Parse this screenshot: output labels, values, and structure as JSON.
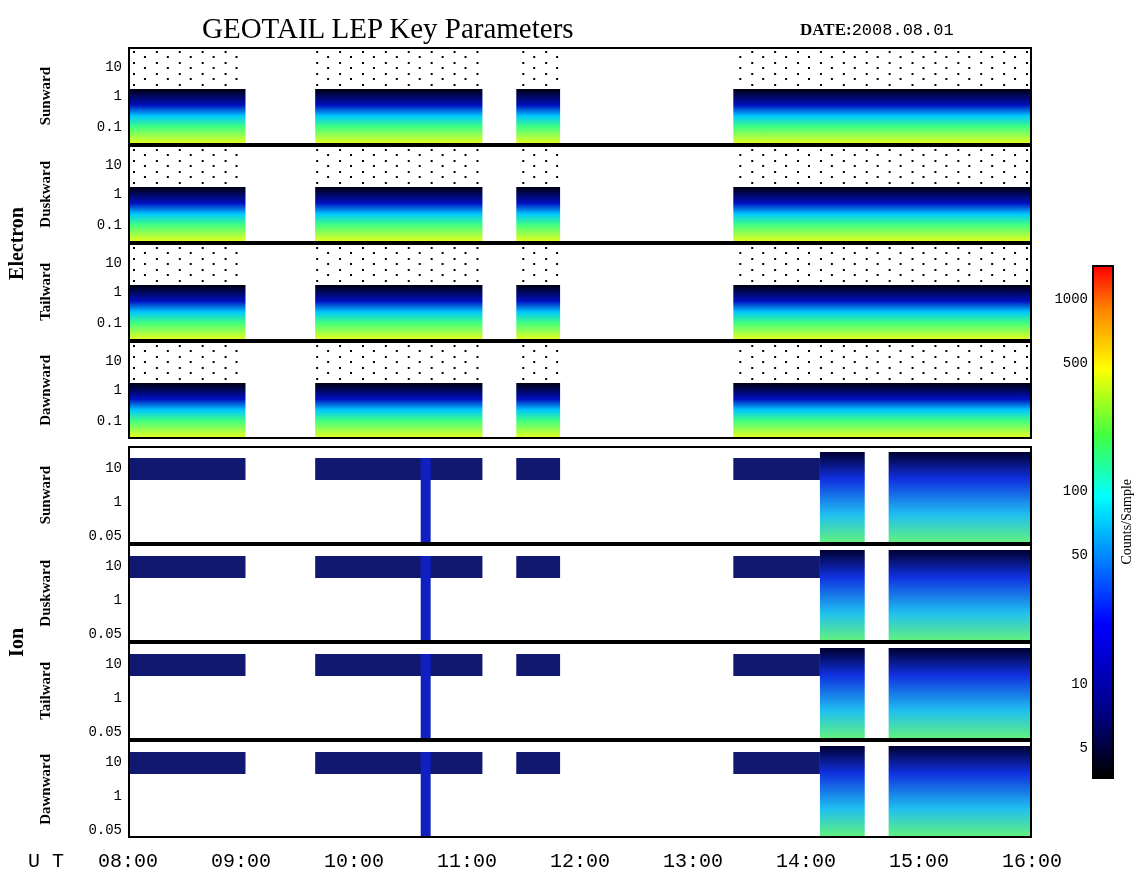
{
  "title": "GEOTAIL LEP Key Parameters",
  "date": {
    "label": "DATE:",
    "value": "2008.08.01"
  },
  "groups": [
    {
      "name": "Electron",
      "kind": "electron",
      "panels": [
        {
          "direction": "Sunward",
          "yticks": [
            "10",
            "1",
            "0.1"
          ]
        },
        {
          "direction": "Duskward",
          "yticks": [
            "10",
            "1",
            "0.1"
          ]
        },
        {
          "direction": "Tailward",
          "yticks": [
            "10",
            "1",
            "0.1"
          ]
        },
        {
          "direction": "Dawnward",
          "yticks": [
            "10",
            "1",
            "0.1"
          ]
        }
      ]
    },
    {
      "name": "Ion",
      "kind": "ion",
      "panels": [
        {
          "direction": "Sunward",
          "yticks": [
            "10",
            "1",
            "0.05"
          ]
        },
        {
          "direction": "Duskward",
          "yticks": [
            "10",
            "1",
            "0.05"
          ]
        },
        {
          "direction": "Tailward",
          "yticks": [
            "10",
            "1",
            "0.05"
          ]
        },
        {
          "direction": "Dawnward",
          "yticks": [
            "10",
            "1",
            "0.05"
          ]
        }
      ]
    }
  ],
  "colorbar": {
    "label": "Counts/Sample",
    "ticks": [
      "1000",
      "500",
      "100",
      "50",
      "10",
      "5"
    ]
  },
  "time_axis": {
    "label": "U T",
    "ticks": [
      "08:00",
      "09:00",
      "10:00",
      "11:00",
      "12:00",
      "13:00",
      "14:00",
      "15:00",
      "16:00"
    ]
  }
}
